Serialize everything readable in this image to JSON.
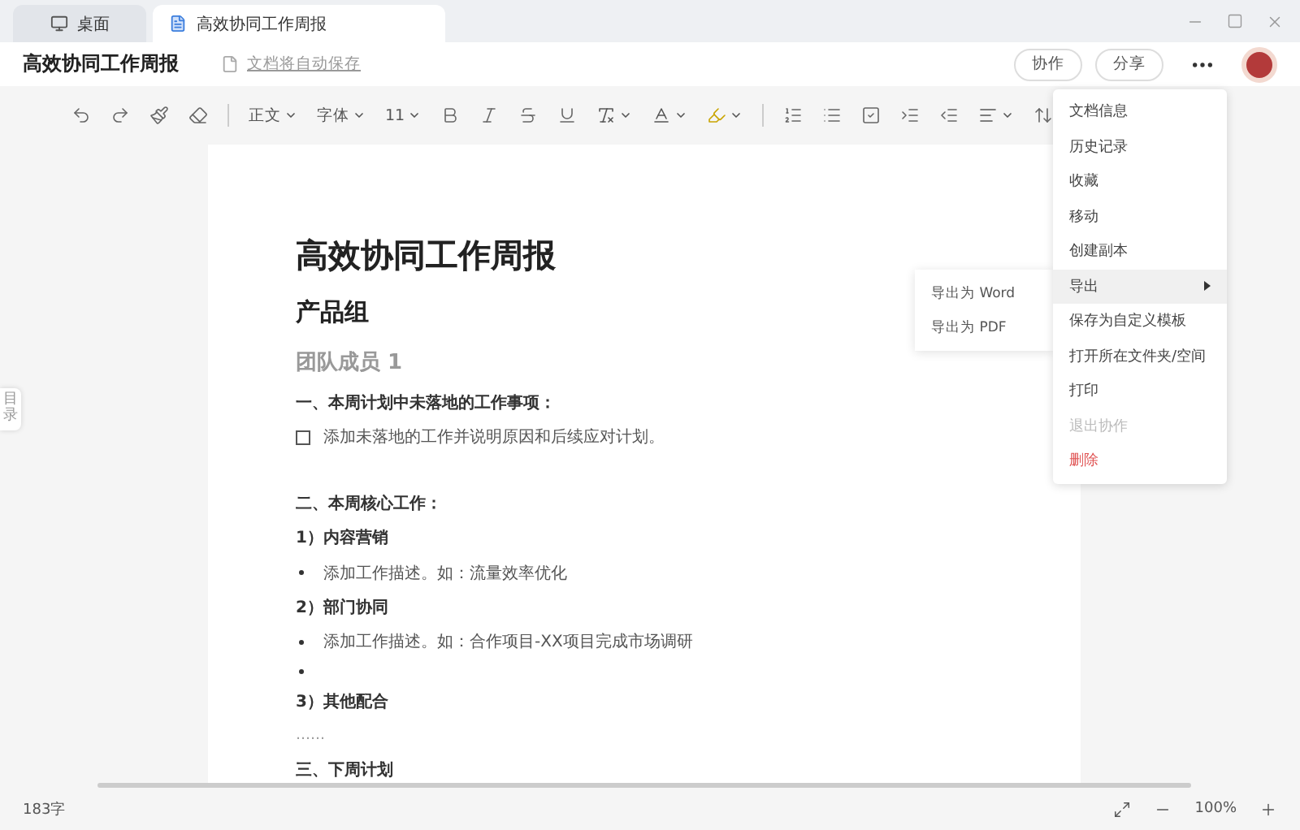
{
  "tabs": [
    {
      "label": "桌面",
      "selected": false
    },
    {
      "label": "高效协同工作周报",
      "selected": true
    }
  ],
  "header": {
    "title": "高效协同工作周报",
    "save_status": "文档将自动保存",
    "buttons": [
      "协作",
      "分享"
    ]
  },
  "toolbar": {
    "style": "正文",
    "font": "字体",
    "size": "11"
  },
  "outline_tab": "目录",
  "document": [
    {
      "kind": "title",
      "text": "高效协同工作周报"
    },
    {
      "kind": "h2",
      "text": "产品组"
    },
    {
      "kind": "member",
      "text": "团队成员 1"
    },
    {
      "kind": "section",
      "text": "一、本周计划中未落地的工作事项："
    },
    {
      "kind": "todo",
      "text": "添加未落地的工作并说明原因和后续应对计划。",
      "checked": false
    },
    {
      "kind": "spacer"
    },
    {
      "kind": "section",
      "text": "二、本周核心工作："
    },
    {
      "kind": "section",
      "text": "1）内容营销"
    },
    {
      "kind": "bullet",
      "text": "添加工作描述。如：流量效率优化"
    },
    {
      "kind": "section",
      "text": "2）部门协同"
    },
    {
      "kind": "bullet",
      "text": "添加工作描述。如：合作项目-XX项目完成市场调研"
    },
    {
      "kind": "empty_bullet"
    },
    {
      "kind": "section",
      "text": "3）其他配合"
    },
    {
      "kind": "plain",
      "text": "……"
    },
    {
      "kind": "section",
      "text": "三、下周计划"
    }
  ],
  "menu": [
    {
      "label": "文档信息",
      "kind": "normal",
      "selected": false
    },
    {
      "label": "历史记录",
      "kind": "normal",
      "selected": false
    },
    {
      "label": "收藏",
      "kind": "normal",
      "selected": false
    },
    {
      "label": "移动",
      "kind": "normal",
      "selected": false
    },
    {
      "label": "创建副本",
      "kind": "normal",
      "selected": false
    },
    {
      "label": "导出",
      "kind": "submenu",
      "selected": true
    },
    {
      "label": "保存为自定义模板",
      "kind": "normal",
      "selected": false
    },
    {
      "label": "打开所在文件夹/空间",
      "kind": "normal",
      "selected": false
    },
    {
      "label": "打印",
      "kind": "normal",
      "selected": false
    },
    {
      "label": "退出协作",
      "kind": "disabled",
      "selected": false
    },
    {
      "label": "删除",
      "kind": "danger",
      "selected": false
    }
  ],
  "submenu": [
    "导出为 Word",
    "导出为 PDF"
  ],
  "status_bar": {
    "word_count": "183字",
    "zoom": "100%"
  }
}
